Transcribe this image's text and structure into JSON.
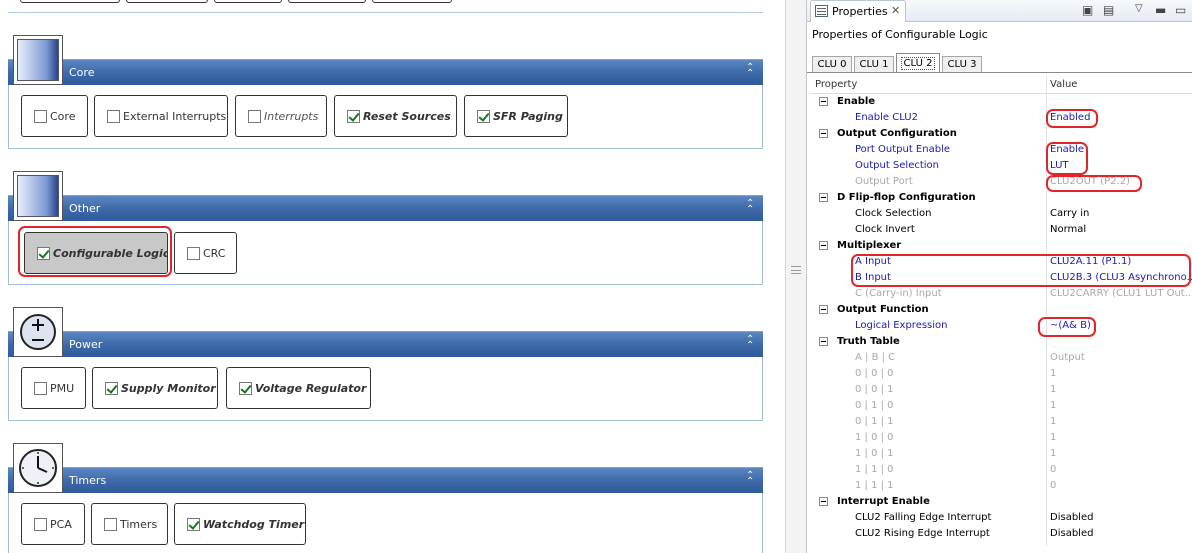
{
  "sections": [
    {
      "title": "Core",
      "items": [
        {
          "label": "Core",
          "checked": false,
          "style": "normal"
        },
        {
          "label": "External Interrupts",
          "checked": false,
          "style": "normal"
        },
        {
          "label": "Interrupts",
          "checked": false,
          "style": "italic"
        },
        {
          "label": "Reset Sources",
          "checked": true,
          "style": "bold"
        },
        {
          "label": "SFR Paging",
          "checked": true,
          "style": "bold"
        }
      ]
    },
    {
      "title": "Other",
      "items": [
        {
          "label": "Configurable Logic",
          "checked": true,
          "style": "bold",
          "selected": true
        },
        {
          "label": "CRC",
          "checked": false,
          "style": "normal"
        }
      ]
    },
    {
      "title": "Power",
      "items": [
        {
          "label": "PMU",
          "checked": false,
          "style": "normal"
        },
        {
          "label": "Supply Monitor",
          "checked": true,
          "style": "bold"
        },
        {
          "label": "Voltage Regulator",
          "checked": true,
          "style": "bold"
        }
      ]
    },
    {
      "title": "Timers",
      "items": [
        {
          "label": "PCA",
          "checked": false,
          "style": "normal"
        },
        {
          "label": "Timers",
          "checked": false,
          "style": "normal"
        },
        {
          "label": "Watchdog Timer",
          "checked": true,
          "style": "bold"
        }
      ]
    }
  ],
  "properties_view": {
    "tab_label": "Properties",
    "title": "Properties of Configurable Logic",
    "clu_tabs": [
      "CLU 0",
      "CLU 1",
      "CLU 2",
      "CLU 3"
    ],
    "active_clu_tab": 2,
    "columns": {
      "property": "Property",
      "value": "Value"
    },
    "rows": [
      {
        "type": "cat",
        "label": "Enable"
      },
      {
        "type": "prop",
        "name": "Enable CLU2",
        "value": "Enabled",
        "state": "blue"
      },
      {
        "type": "cat",
        "label": "Output Configuration"
      },
      {
        "type": "prop",
        "name": "Port Output Enable",
        "value": "Enable",
        "state": "blue"
      },
      {
        "type": "prop",
        "name": "Output Selection",
        "value": "LUT",
        "state": "blue"
      },
      {
        "type": "prop",
        "name": "Output Port",
        "value": "CLU2OUT (P2.2)",
        "state": "gray"
      },
      {
        "type": "cat",
        "label": "D Flip-flop Configuration"
      },
      {
        "type": "prop",
        "name": "Clock Selection",
        "value": "Carry in",
        "state": "normal"
      },
      {
        "type": "prop",
        "name": "Clock Invert",
        "value": "Normal",
        "state": "normal"
      },
      {
        "type": "cat",
        "label": "Multiplexer"
      },
      {
        "type": "prop",
        "name": "A Input",
        "value": "CLU2A.11 (P1.1)",
        "state": "blue"
      },
      {
        "type": "prop",
        "name": "B Input",
        "value": "CLU2B.3 (CLU3 Asynchrono...",
        "state": "blue"
      },
      {
        "type": "prop",
        "name": "C (Carry-in) Input",
        "value": "CLU2CARRY (CLU1 LUT Out...",
        "state": "gray"
      },
      {
        "type": "cat",
        "label": "Output Function"
      },
      {
        "type": "prop",
        "name": "Logical Expression",
        "value": "~(A& B)",
        "state": "blue"
      },
      {
        "type": "cat",
        "label": "Truth Table"
      },
      {
        "type": "prop",
        "name": "A  | B  | C",
        "value": "Output",
        "state": "gray"
      },
      {
        "type": "prop",
        "name": "0  | 0  | 0",
        "value": "1",
        "state": "gray"
      },
      {
        "type": "prop",
        "name": "0  | 0  | 1",
        "value": "1",
        "state": "gray"
      },
      {
        "type": "prop",
        "name": "0  | 1  | 0",
        "value": "1",
        "state": "gray"
      },
      {
        "type": "prop",
        "name": "0  | 1  | 1",
        "value": "1",
        "state": "gray"
      },
      {
        "type": "prop",
        "name": "1  | 0  | 0",
        "value": "1",
        "state": "gray"
      },
      {
        "type": "prop",
        "name": "1  | 0  | 1",
        "value": "1",
        "state": "gray"
      },
      {
        "type": "prop",
        "name": "1  | 1  | 0",
        "value": "0",
        "state": "gray"
      },
      {
        "type": "prop",
        "name": "1  | 1  | 1",
        "value": "0",
        "state": "gray"
      },
      {
        "type": "cat",
        "label": "Interrupt Enable"
      },
      {
        "type": "prop",
        "name": "CLU2 Falling Edge Interrupt",
        "value": "Disabled",
        "state": "normal"
      },
      {
        "type": "prop",
        "name": "CLU2 Rising Edge Interrupt",
        "value": "Disabled",
        "state": "normal"
      }
    ]
  },
  "colors": {
    "section_bar": "#3d68a8",
    "highlight_ring": "#e0252b",
    "modified_value": "#1a1ab5",
    "disabled_value": "#a8a8a8"
  }
}
